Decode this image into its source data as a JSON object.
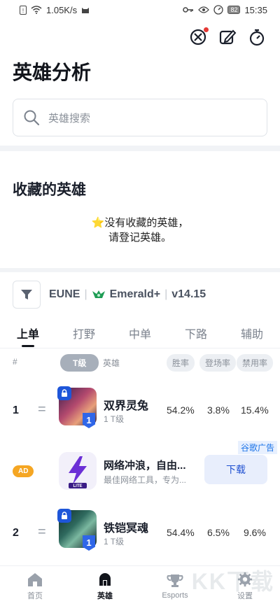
{
  "status_bar": {
    "speed": "1.05K/s",
    "battery": "82",
    "time": "15:35"
  },
  "page": {
    "title": "英雄分析"
  },
  "search": {
    "placeholder": "英雄搜索"
  },
  "favorites": {
    "title": "收藏的英雄",
    "empty_line1": "⭐没有收藏的英雄，",
    "empty_line2": "请登记英雄。"
  },
  "filter": {
    "region": "EUNE",
    "rank": "Emerald+",
    "version": "v14.15"
  },
  "tabs": [
    {
      "label": "上单",
      "active": true
    },
    {
      "label": "打野"
    },
    {
      "label": "中单"
    },
    {
      "label": "下路"
    },
    {
      "label": "辅助"
    }
  ],
  "columns": {
    "index": "#",
    "tier": "T级",
    "hero": "英雄",
    "winrate": "胜率",
    "pickrate": "登场率",
    "banrate": "禁用率"
  },
  "heroes": [
    {
      "rank": "1",
      "change": "=",
      "name": "双界灵兔",
      "tier_text": "1 T级",
      "tier_badge": "1",
      "winrate": "54.2%",
      "pickrate": "3.8%",
      "banrate": "15.4%"
    },
    {
      "rank": "2",
      "change": "=",
      "name": "铁铠冥魂",
      "tier_text": "1 T级",
      "tier_badge": "1",
      "winrate": "54.4%",
      "pickrate": "6.5%",
      "banrate": "9.6%"
    }
  ],
  "ad": {
    "badge": "AD",
    "label": "谷歌广告",
    "title": "网络冲浪，自由...",
    "subtitle": "最佳网络工具，专为...",
    "button": "下载",
    "icon_text": "LITE"
  },
  "nav": [
    {
      "label": "首页",
      "icon": "home-icon"
    },
    {
      "label": "英雄",
      "icon": "hero-helmet-icon",
      "active": true
    },
    {
      "label": "Esports",
      "icon": "trophy-icon"
    },
    {
      "label": "设置",
      "icon": "gear-icon"
    }
  ],
  "watermark": "KK下载",
  "colors": {
    "accent": "#1e56d9",
    "ad_badge": "#f5a623",
    "text": "#1a1f2b"
  }
}
